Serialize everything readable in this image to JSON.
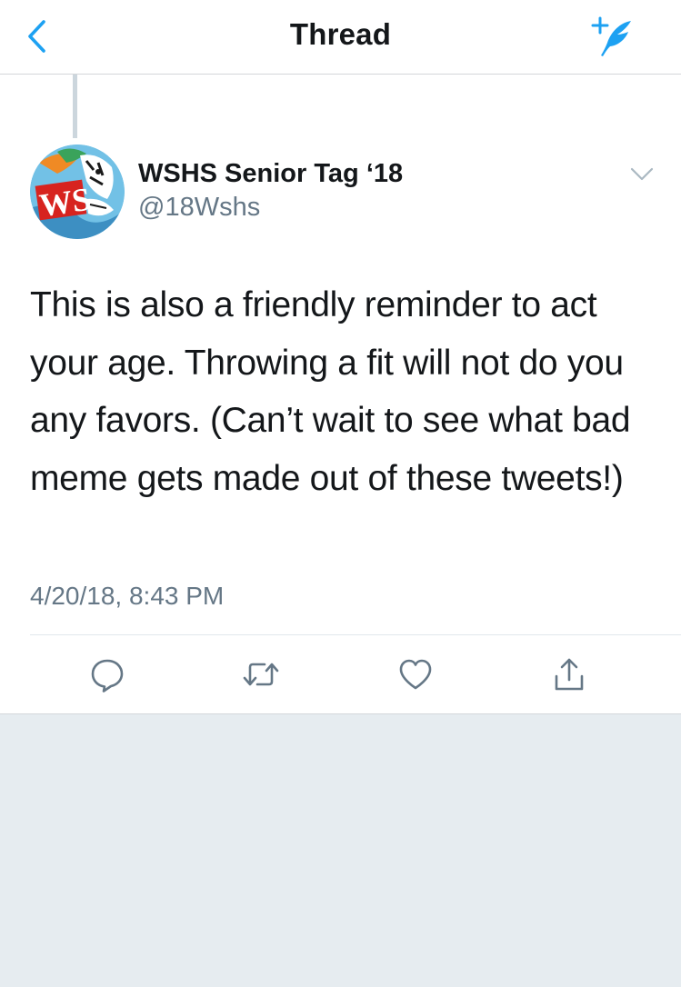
{
  "colors": {
    "accent": "#1da1f2",
    "text_primary": "#14171a",
    "text_secondary": "#657786",
    "icon_gray": "#657786",
    "background": "#e6ecf0"
  },
  "navbar": {
    "title": "Thread",
    "back_icon": "chevron-left-icon",
    "compose_icon": "compose-tweet-icon"
  },
  "tweet": {
    "author_name": "WSHS Senior Tag ‘18",
    "author_handle": "@18Wshs",
    "avatar_text": "WS",
    "text": "This is also a friendly reminder to act your age. Throwing a fit will not do you any favors. (Can’t wait to see what bad meme gets made out of these tweets!)",
    "timestamp": "4/20/18, 8:43 PM",
    "actions": [
      {
        "name": "reply",
        "icon": "reply-icon"
      },
      {
        "name": "retweet",
        "icon": "retweet-icon"
      },
      {
        "name": "like",
        "icon": "heart-icon"
      },
      {
        "name": "share",
        "icon": "share-icon"
      }
    ]
  }
}
